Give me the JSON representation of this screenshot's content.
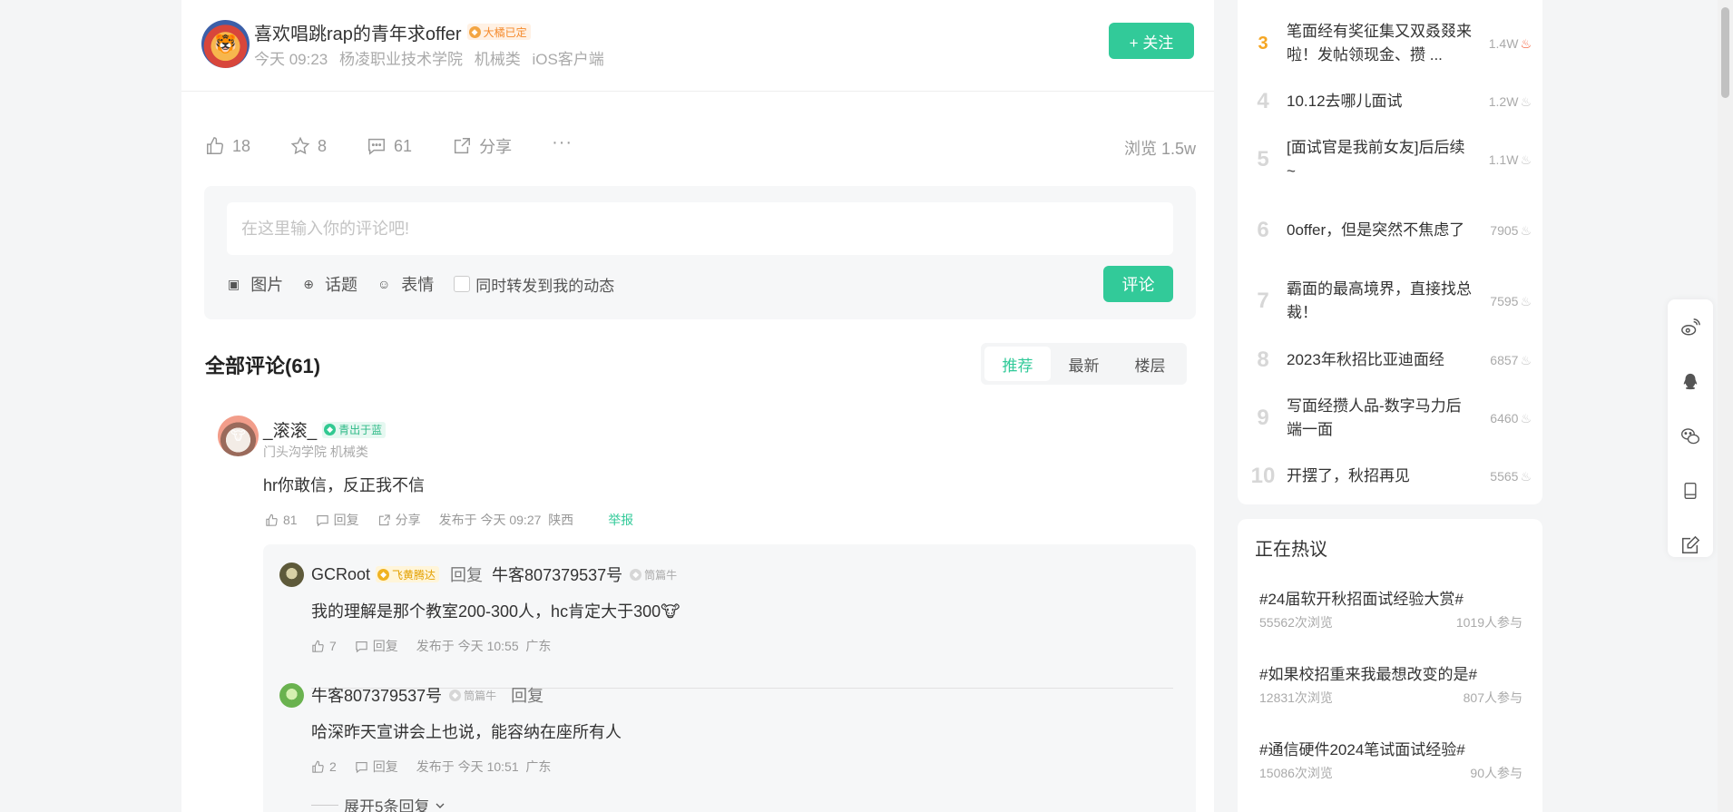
{
  "post": {
    "author_name": "喜欢唱跳rap的青年求offer",
    "author_badge": "大橘已定",
    "time": "今天 09:23",
    "school": "杨凌职业技术学院",
    "major": "机械类",
    "client": "iOS客户端",
    "follow_label": "+ 关注",
    "likes": "18",
    "stars": "8",
    "comments": "61",
    "share_label": "分享",
    "more_label": "···",
    "views": "浏览 1.5w"
  },
  "comment_box": {
    "placeholder": "在这里输入你的评论吧!",
    "image_label": "图片",
    "topic_label": "话题",
    "emoji_label": "表情",
    "repost_label": "同时转发到我的动态",
    "submit_label": "评论"
  },
  "comments_section": {
    "title": "全部评论(61)",
    "tabs": [
      "推荐",
      "最新",
      "楼层"
    ],
    "active_tab": "推荐"
  },
  "comment": {
    "user": "_滚滚_",
    "badge": "青出于蓝",
    "school": "门头沟学院 机械类",
    "text": "hr你敢信，反正我不信",
    "likes": "81",
    "reply_label": "回复",
    "share_label": "分享",
    "published": "发布于 今天 09:27",
    "location": "陕西",
    "report_label": "举报"
  },
  "replies": [
    {
      "user": "GCRoot",
      "badge": "飞黄腾达",
      "reply_word": "回复",
      "target": "牛客807379537号",
      "target_badge": "筒篇牛",
      "text": "我的理解是那个教室200-300人，hc肯定大于300🐮",
      "likes": "7",
      "reply_label": "回复",
      "published": "发布于 今天 10:55",
      "location": "广东"
    },
    {
      "user": "牛客807379537号",
      "badge": "筒篇牛",
      "reply_word": "回复",
      "text": "哈深昨天宣讲会上也说，能容纳在座所有人",
      "likes": "2",
      "reply_label": "回复",
      "published": "发布于 今天 10:51",
      "location": "广东"
    }
  ],
  "expand_label": "展开5条回复",
  "hot_list": [
    {
      "rank": "3",
      "title": "笔面经有奖征集又双叒叕来啦！发帖领现金、攒 ...",
      "count": "1.4W",
      "hot": true
    },
    {
      "rank": "4",
      "title": "10.12去哪儿面试",
      "count": "1.2W",
      "hot": false
    },
    {
      "rank": "5",
      "title": "[面试官是我前女友]后后续~",
      "count": "1.1W",
      "hot": false
    },
    {
      "rank": "6",
      "title": "0offer，但是突然不焦虑了",
      "count": "7905",
      "hot": false
    },
    {
      "rank": "7",
      "title": "霸面的最高境界，直接找总裁！",
      "count": "7595",
      "hot": false
    },
    {
      "rank": "8",
      "title": "2023年秋招比亚迪面经",
      "count": "6857",
      "hot": false
    },
    {
      "rank": "9",
      "title": "写面经攒人品-数字马力后端一面",
      "count": "6460",
      "hot": false
    },
    {
      "rank": "10",
      "title": "开摆了，秋招再见",
      "count": "5565",
      "hot": false
    }
  ],
  "hot_topics": {
    "title": "正在热议",
    "items": [
      {
        "name": "#24届软开秋招面试经验大赏#",
        "views": "55562次浏览",
        "participants": "1019人参与"
      },
      {
        "name": "#如果校招重来我最想改变的是#",
        "views": "12831次浏览",
        "participants": "807人参与"
      },
      {
        "name": "#通信硬件2024笔试面试经验#",
        "views": "15086次浏览",
        "participants": "90人参与"
      }
    ]
  },
  "colors": {
    "accent": "#32ca99",
    "hot": "#f5532d",
    "rank3": "#f5a623"
  },
  "share_icons": [
    "weibo-icon",
    "qq-icon",
    "wechat-icon",
    "mobile-icon",
    "edit-icon"
  ]
}
